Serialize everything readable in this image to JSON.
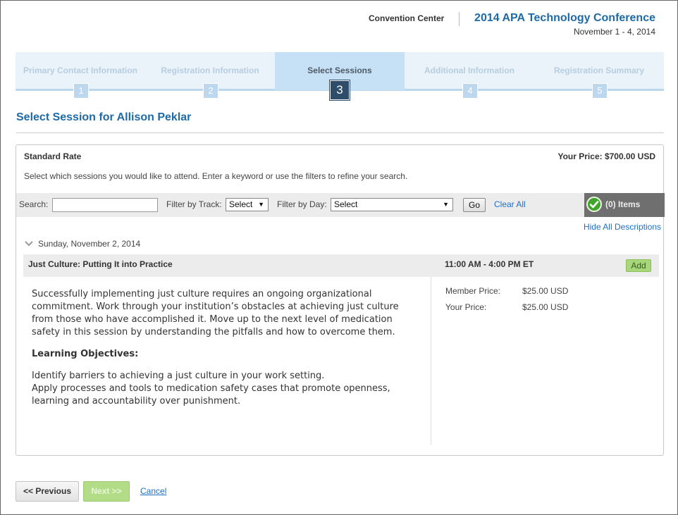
{
  "header": {
    "venue": "Convention Center",
    "conference_title": "2014 APA Technology Conference",
    "conference_dates": "November 1 - 4, 2014"
  },
  "steps": [
    {
      "label": "Primary Contact Information",
      "number": "1",
      "active": false
    },
    {
      "label": "Registration Information",
      "number": "2",
      "active": false
    },
    {
      "label": "Select Sessions",
      "number": "3",
      "active": true
    },
    {
      "label": "Additional Information",
      "number": "4",
      "active": false
    },
    {
      "label": "Registration Summary",
      "number": "5",
      "active": false
    }
  ],
  "page_title": "Select Session for Allison Peklar",
  "rate": {
    "label": "Standard Rate",
    "your_price": "Your Price: $700.00 USD"
  },
  "instructions": "Select which sessions you would like to attend. Enter a keyword or use the filters to refine your search.",
  "filters": {
    "search_label": "Search:",
    "search_value": "",
    "track_label": "Filter by Track:",
    "track_value": "Select",
    "day_label": "Filter by Day:",
    "day_value": "Select",
    "go_label": "Go",
    "clear_all_label": "Clear All",
    "items_label": "(0) Items"
  },
  "hide_descriptions_label": "Hide All Descriptions",
  "day": "Sunday, November 2, 2014",
  "session": {
    "title": "Just Culture: Putting It into Practice",
    "time": "11:00 AM - 4:00 PM ET",
    "add_label": "Add",
    "description": "Successfully implementing just culture requires an ongoing organizational commitment. Work through your institution’s obstacles at achieving just culture from those who have accomplished it. Move up to the next level of medication safety in this session by understanding the pitfalls and how to overcome them.",
    "objectives_heading": "Learning Objectives:",
    "objectives": [
      "Identify barriers to achieving a just culture in your work setting.",
      "Apply processes and tools to medication safety cases that promote openness, learning and accountability over punishment."
    ],
    "member_price_label": "Member Price:",
    "member_price": "$25.00 USD",
    "your_price_label": "Your Price:",
    "your_price": "$25.00 USD"
  },
  "nav": {
    "previous_label": "<< Previous",
    "next_label": "Next >>",
    "cancel_label": "Cancel"
  },
  "colors": {
    "accent_blue": "#1f6aa5",
    "link_blue": "#1e6fc4",
    "active_step": "#2e4d6b",
    "add_green": "#a8d67a",
    "check_green": "#3fa62b"
  }
}
